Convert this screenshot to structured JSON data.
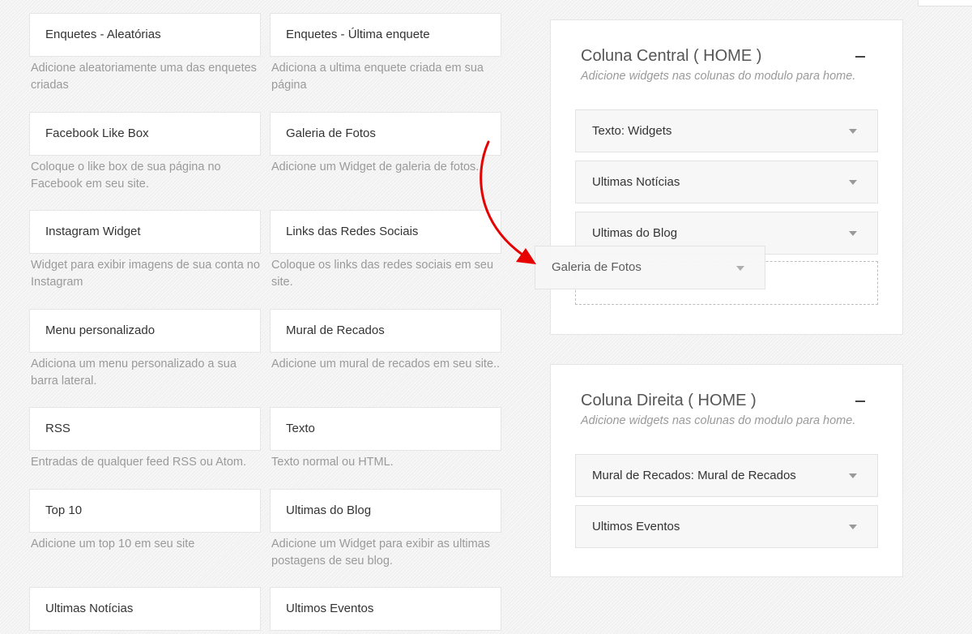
{
  "available_widgets": [
    {
      "title": "Enquetes - Aleatórias",
      "description": "Adicione aleatoriamente uma das enquetes criadas"
    },
    {
      "title": "Enquetes - Última enquete",
      "description": "Adiciona a ultima enquete criada em sua página"
    },
    {
      "title": "Facebook Like Box",
      "description": "Coloque o like box de sua página no Facebook em seu site."
    },
    {
      "title": "Galeria de Fotos",
      "description": "Adicione um Widget de galeria de fotos."
    },
    {
      "title": "Instagram Widget",
      "description": "Widget para exibir imagens de sua conta no Instagram"
    },
    {
      "title": "Links das Redes Sociais",
      "description": "Coloque os links das redes sociais em seu site."
    },
    {
      "title": "Menu personalizado",
      "description": "Adiciona um menu personalizado a sua barra lateral."
    },
    {
      "title": "Mural de Recados",
      "description": "Adicione um mural de recados em seu site.."
    },
    {
      "title": "RSS",
      "description": "Entradas de qualquer feed RSS ou Atom."
    },
    {
      "title": "Texto",
      "description": "Texto normal ou HTML."
    },
    {
      "title": "Top 10",
      "description": "Adicione um top 10 em seu site"
    },
    {
      "title": "Ultimas do Blog",
      "description": "Adicione um Widget para exibir as ultimas postagens de seu blog."
    },
    {
      "title": "Ultimas Notícias",
      "description": ""
    },
    {
      "title": "Ultimos Eventos",
      "description": ""
    }
  ],
  "sidebars": [
    {
      "title": "Coluna Central ( HOME )",
      "subtitle": "Adicione widgets nas colunas do modulo para home.",
      "widgets": [
        "Texto: Widgets",
        "Ultimas Notícias",
        "Ultimas do Blog"
      ]
    },
    {
      "title": "Coluna Direita ( HOME )",
      "subtitle": "Adicione widgets nas colunas do modulo para home.",
      "widgets": [
        "Mural de Recados: Mural de Recados",
        "Ultimos Eventos"
      ]
    }
  ],
  "dragging_widget": {
    "title": "Galeria de Fotos"
  },
  "icons": {
    "collapse": "minus-icon",
    "expand_widget": "caret-down-icon",
    "drag_hint": "curved-arrow-icon"
  },
  "colors": {
    "accent_arrow": "#e60000"
  }
}
